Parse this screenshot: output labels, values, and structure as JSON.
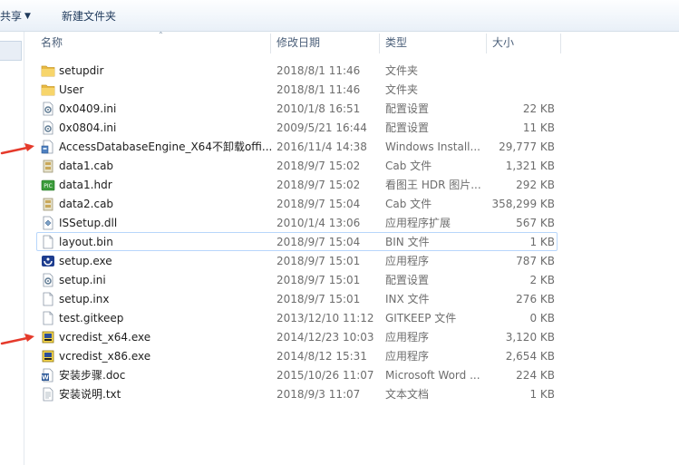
{
  "toolbar": {
    "share_label": "共享",
    "share_caret": "▼",
    "new_folder_label": "新建文件夹"
  },
  "columns": {
    "name": "名称",
    "date": "修改日期",
    "type": "类型",
    "size": "大小",
    "sort_indicator": "⌃"
  },
  "files": [
    {
      "name": "setupdir",
      "date": "2018/8/1 11:46",
      "type": "文件夹",
      "size": "",
      "icon": "folder-icon"
    },
    {
      "name": "User",
      "date": "2018/8/1 11:46",
      "type": "文件夹",
      "size": "",
      "icon": "folder-icon"
    },
    {
      "name": "0x0409.ini",
      "date": "2010/1/8 16:51",
      "type": "配置设置",
      "size": "22 KB",
      "icon": "config-file-icon"
    },
    {
      "name": "0x0804.ini",
      "date": "2009/5/21 16:44",
      "type": "配置设置",
      "size": "11 KB",
      "icon": "config-file-icon"
    },
    {
      "name": "AccessDatabaseEngine_X64不卸载offi...",
      "date": "2016/11/4 14:38",
      "type": "Windows Install...",
      "size": "29,777 KB",
      "icon": "installer-package-icon"
    },
    {
      "name": "data1.cab",
      "date": "2018/9/7 15:02",
      "type": "Cab 文件",
      "size": "1,321 KB",
      "icon": "cab-file-icon"
    },
    {
      "name": "data1.hdr",
      "date": "2018/9/7 15:02",
      "type": "看图王 HDR 图片...",
      "size": "292 KB",
      "icon": "picture-file-icon"
    },
    {
      "name": "data2.cab",
      "date": "2018/9/7 15:04",
      "type": "Cab 文件",
      "size": "358,299 KB",
      "icon": "cab-file-icon"
    },
    {
      "name": "ISSetup.dll",
      "date": "2010/1/4 13:06",
      "type": "应用程序扩展",
      "size": "567 KB",
      "icon": "dll-file-icon"
    },
    {
      "name": "layout.bin",
      "date": "2018/9/7 15:04",
      "type": "BIN 文件",
      "size": "1 KB",
      "icon": "blank-file-icon"
    },
    {
      "name": "setup.exe",
      "date": "2018/9/7 15:01",
      "type": "应用程序",
      "size": "787 KB",
      "icon": "setup-exe-icon"
    },
    {
      "name": "setup.ini",
      "date": "2018/9/7 15:01",
      "type": "配置设置",
      "size": "2 KB",
      "icon": "config-file-icon"
    },
    {
      "name": "setup.inx",
      "date": "2018/9/7 15:01",
      "type": "INX 文件",
      "size": "276 KB",
      "icon": "blank-file-icon"
    },
    {
      "name": "test.gitkeep",
      "date": "2013/12/10 11:12",
      "type": "GITKEEP 文件",
      "size": "0 KB",
      "icon": "blank-file-icon"
    },
    {
      "name": "vcredist_x64.exe",
      "date": "2014/12/23 10:03",
      "type": "应用程序",
      "size": "3,120 KB",
      "icon": "vcredist-exe-icon"
    },
    {
      "name": "vcredist_x86.exe",
      "date": "2014/8/12 15:31",
      "type": "应用程序",
      "size": "2,654 KB",
      "icon": "vcredist-exe-icon"
    },
    {
      "name": "安装步骤.doc",
      "date": "2015/10/26 11:07",
      "type": "Microsoft Word ...",
      "size": "224 KB",
      "icon": "word-doc-icon"
    },
    {
      "name": "安装说明.txt",
      "date": "2018/9/3 11:07",
      "type": "文本文档",
      "size": "1 KB",
      "icon": "text-file-icon"
    }
  ],
  "highlighted_row": 9,
  "annotation_arrows": [
    4,
    14
  ],
  "colors": {
    "folder": "#e8b943",
    "arrow": "#e53a2b",
    "hover_border": "#b8d6fb",
    "header_text": "#4c607a"
  }
}
